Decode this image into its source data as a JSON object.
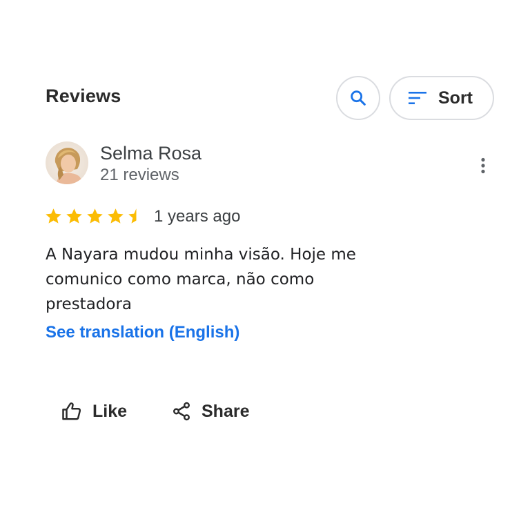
{
  "header": {
    "title": "Reviews",
    "sort_label": "Sort"
  },
  "review": {
    "author": "Selma Rosa",
    "author_reviews": "21 reviews",
    "rating": 4.5,
    "rating_max": 5,
    "time_ago": "1 years ago",
    "text": "A Nayara mudou minha visão. Hoje me comunico como marca, não como prestadora",
    "translate_label": "See translation (English)"
  },
  "actions": {
    "like_label": "Like",
    "share_label": "Share"
  },
  "colors": {
    "accent": "#1a73e8",
    "star": "#fbbc04",
    "border": "#dadce0"
  }
}
